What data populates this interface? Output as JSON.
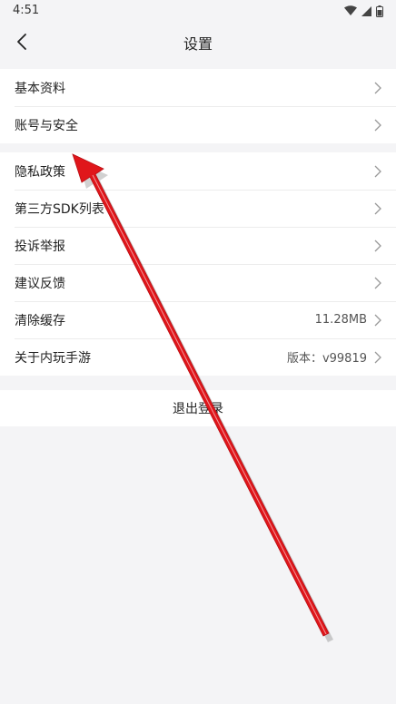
{
  "status_bar": {
    "time": "4:51",
    "icons": [
      "wifi-icon",
      "signal-icon",
      "battery-icon"
    ]
  },
  "header": {
    "title": "设置",
    "back_icon": "chevron-left-icon"
  },
  "groups": [
    {
      "items": [
        {
          "label": "基本资料"
        },
        {
          "label": "账号与安全"
        }
      ]
    },
    {
      "items": [
        {
          "label": "隐私政策"
        },
        {
          "label": "第三方SDK列表"
        },
        {
          "label": "投诉举报"
        },
        {
          "label": "建议反馈"
        },
        {
          "label": "清除缓存",
          "value": "11.28MB"
        },
        {
          "label": "关于内玩手游",
          "value": "版本：v99819"
        }
      ]
    }
  ],
  "logout": {
    "label": "退出登录"
  },
  "annotation": {
    "color": "#e0161b",
    "points_to": "账号与安全"
  },
  "colors": {
    "background": "#f4f4f6",
    "row_background": "#ffffff",
    "divider": "#ececec"
  }
}
